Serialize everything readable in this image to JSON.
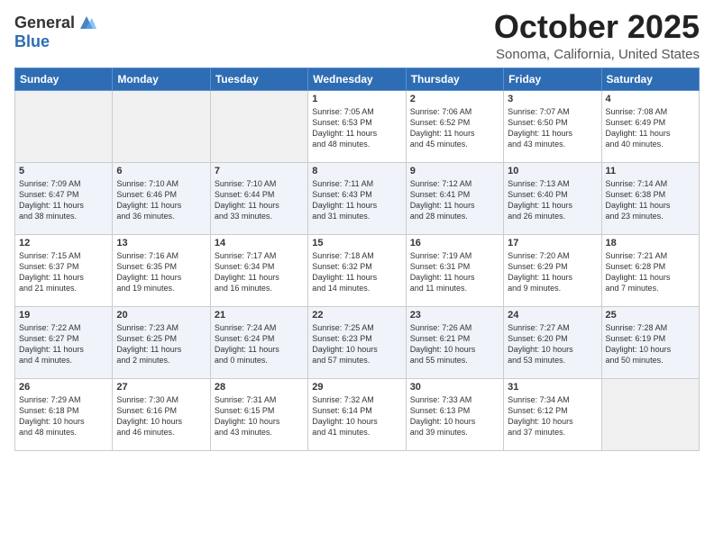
{
  "header": {
    "logo_general": "General",
    "logo_blue": "Blue",
    "month_title": "October 2025",
    "location": "Sonoma, California, United States"
  },
  "weekdays": [
    "Sunday",
    "Monday",
    "Tuesday",
    "Wednesday",
    "Thursday",
    "Friday",
    "Saturday"
  ],
  "weeks": [
    [
      {
        "day": "",
        "info": ""
      },
      {
        "day": "",
        "info": ""
      },
      {
        "day": "",
        "info": ""
      },
      {
        "day": "1",
        "info": "Sunrise: 7:05 AM\nSunset: 6:53 PM\nDaylight: 11 hours\nand 48 minutes."
      },
      {
        "day": "2",
        "info": "Sunrise: 7:06 AM\nSunset: 6:52 PM\nDaylight: 11 hours\nand 45 minutes."
      },
      {
        "day": "3",
        "info": "Sunrise: 7:07 AM\nSunset: 6:50 PM\nDaylight: 11 hours\nand 43 minutes."
      },
      {
        "day": "4",
        "info": "Sunrise: 7:08 AM\nSunset: 6:49 PM\nDaylight: 11 hours\nand 40 minutes."
      }
    ],
    [
      {
        "day": "5",
        "info": "Sunrise: 7:09 AM\nSunset: 6:47 PM\nDaylight: 11 hours\nand 38 minutes."
      },
      {
        "day": "6",
        "info": "Sunrise: 7:10 AM\nSunset: 6:46 PM\nDaylight: 11 hours\nand 36 minutes."
      },
      {
        "day": "7",
        "info": "Sunrise: 7:10 AM\nSunset: 6:44 PM\nDaylight: 11 hours\nand 33 minutes."
      },
      {
        "day": "8",
        "info": "Sunrise: 7:11 AM\nSunset: 6:43 PM\nDaylight: 11 hours\nand 31 minutes."
      },
      {
        "day": "9",
        "info": "Sunrise: 7:12 AM\nSunset: 6:41 PM\nDaylight: 11 hours\nand 28 minutes."
      },
      {
        "day": "10",
        "info": "Sunrise: 7:13 AM\nSunset: 6:40 PM\nDaylight: 11 hours\nand 26 minutes."
      },
      {
        "day": "11",
        "info": "Sunrise: 7:14 AM\nSunset: 6:38 PM\nDaylight: 11 hours\nand 23 minutes."
      }
    ],
    [
      {
        "day": "12",
        "info": "Sunrise: 7:15 AM\nSunset: 6:37 PM\nDaylight: 11 hours\nand 21 minutes."
      },
      {
        "day": "13",
        "info": "Sunrise: 7:16 AM\nSunset: 6:35 PM\nDaylight: 11 hours\nand 19 minutes."
      },
      {
        "day": "14",
        "info": "Sunrise: 7:17 AM\nSunset: 6:34 PM\nDaylight: 11 hours\nand 16 minutes."
      },
      {
        "day": "15",
        "info": "Sunrise: 7:18 AM\nSunset: 6:32 PM\nDaylight: 11 hours\nand 14 minutes."
      },
      {
        "day": "16",
        "info": "Sunrise: 7:19 AM\nSunset: 6:31 PM\nDaylight: 11 hours\nand 11 minutes."
      },
      {
        "day": "17",
        "info": "Sunrise: 7:20 AM\nSunset: 6:29 PM\nDaylight: 11 hours\nand 9 minutes."
      },
      {
        "day": "18",
        "info": "Sunrise: 7:21 AM\nSunset: 6:28 PM\nDaylight: 11 hours\nand 7 minutes."
      }
    ],
    [
      {
        "day": "19",
        "info": "Sunrise: 7:22 AM\nSunset: 6:27 PM\nDaylight: 11 hours\nand 4 minutes."
      },
      {
        "day": "20",
        "info": "Sunrise: 7:23 AM\nSunset: 6:25 PM\nDaylight: 11 hours\nand 2 minutes."
      },
      {
        "day": "21",
        "info": "Sunrise: 7:24 AM\nSunset: 6:24 PM\nDaylight: 11 hours\nand 0 minutes."
      },
      {
        "day": "22",
        "info": "Sunrise: 7:25 AM\nSunset: 6:23 PM\nDaylight: 10 hours\nand 57 minutes."
      },
      {
        "day": "23",
        "info": "Sunrise: 7:26 AM\nSunset: 6:21 PM\nDaylight: 10 hours\nand 55 minutes."
      },
      {
        "day": "24",
        "info": "Sunrise: 7:27 AM\nSunset: 6:20 PM\nDaylight: 10 hours\nand 53 minutes."
      },
      {
        "day": "25",
        "info": "Sunrise: 7:28 AM\nSunset: 6:19 PM\nDaylight: 10 hours\nand 50 minutes."
      }
    ],
    [
      {
        "day": "26",
        "info": "Sunrise: 7:29 AM\nSunset: 6:18 PM\nDaylight: 10 hours\nand 48 minutes."
      },
      {
        "day": "27",
        "info": "Sunrise: 7:30 AM\nSunset: 6:16 PM\nDaylight: 10 hours\nand 46 minutes."
      },
      {
        "day": "28",
        "info": "Sunrise: 7:31 AM\nSunset: 6:15 PM\nDaylight: 10 hours\nand 43 minutes."
      },
      {
        "day": "29",
        "info": "Sunrise: 7:32 AM\nSunset: 6:14 PM\nDaylight: 10 hours\nand 41 minutes."
      },
      {
        "day": "30",
        "info": "Sunrise: 7:33 AM\nSunset: 6:13 PM\nDaylight: 10 hours\nand 39 minutes."
      },
      {
        "day": "31",
        "info": "Sunrise: 7:34 AM\nSunset: 6:12 PM\nDaylight: 10 hours\nand 37 minutes."
      },
      {
        "day": "",
        "info": ""
      }
    ]
  ]
}
